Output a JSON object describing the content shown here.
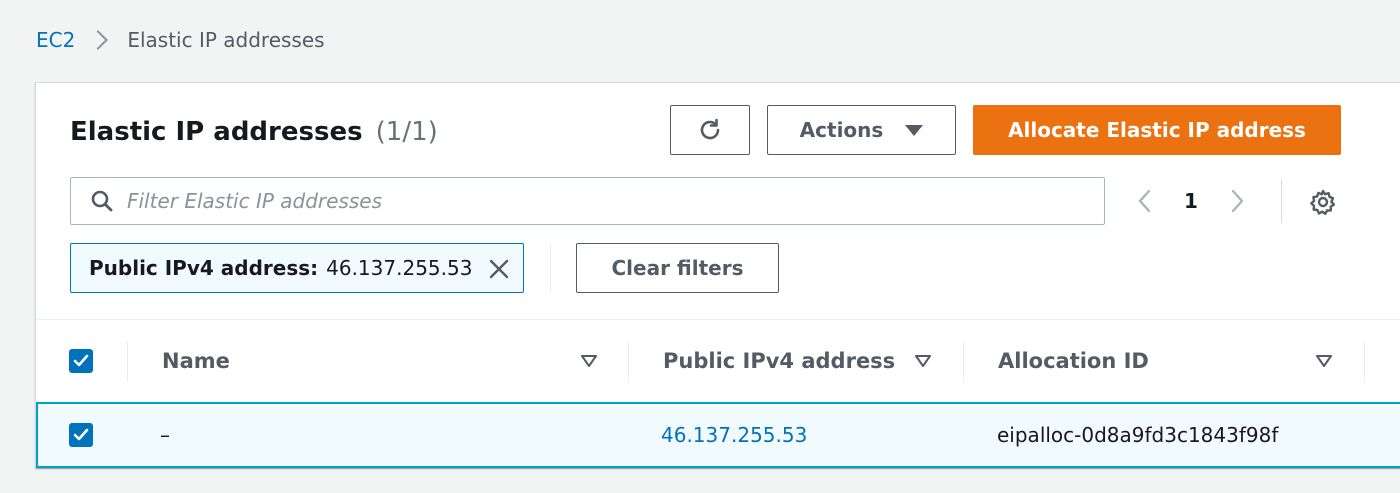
{
  "breadcrumb": {
    "parent": "EC2",
    "current": "Elastic IP addresses"
  },
  "header": {
    "title": "Elastic IP addresses",
    "count": "(1/1)",
    "actions_label": "Actions",
    "allocate_label": "Allocate Elastic IP address"
  },
  "filter": {
    "placeholder": "Filter Elastic IP addresses"
  },
  "pagination": {
    "current_page": "1"
  },
  "token": {
    "key": "Public IPv4 address:",
    "value": "46.137.255.53"
  },
  "clear_filters_label": "Clear filters",
  "table": {
    "columns": [
      "Name",
      "Public IPv4 address",
      "Allocation ID"
    ],
    "rows": [
      {
        "selected": true,
        "name": "–",
        "public_ipv4": "46.137.255.53",
        "allocation_id": "eipalloc-0d8a9fd3c1843f98f"
      }
    ]
  },
  "colors": {
    "primary": "#ec7211",
    "link": "#0073bb",
    "selected_row_bg": "#f1faff",
    "selected_row_border": "#00a1c9"
  },
  "icons": [
    "refresh-icon",
    "caret-down-icon",
    "search-icon",
    "chevron-left-icon",
    "chevron-right-icon",
    "gear-icon",
    "close-icon",
    "sort-icon",
    "checkmark-icon"
  ]
}
